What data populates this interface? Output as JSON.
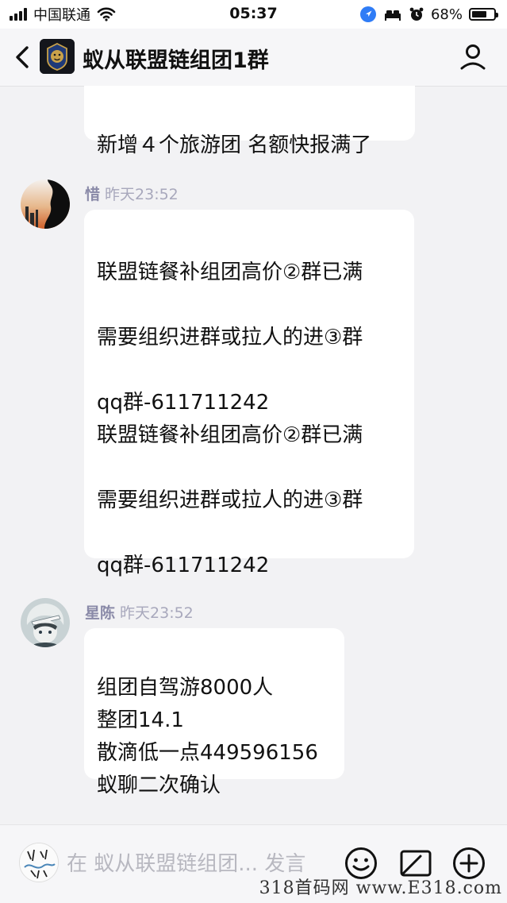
{
  "status_bar": {
    "carrier": "中国联通",
    "time": "05:37",
    "battery_percent": "68%",
    "battery_level": 0.68
  },
  "nav": {
    "title": "蚁从联盟链组团1群"
  },
  "messages": [
    {
      "text": "新增４个旅游团 名额快报满了"
    },
    {
      "sender": "惜",
      "time": "昨天23:52",
      "text": "联盟链餐补组团高价②群已满\n\n需要组织进群或拉人的进③群\n\n qq群-611711242\n联盟链餐补组团高价②群已满\n\n需要组织进群或拉人的进③群\n\n qq群-611711242"
    },
    {
      "sender": "星陈",
      "time": "昨天23:52",
      "text": "组团自驾游8000人\n整团14.1\n散滴低一点449596156\n蚁聊二次确认"
    }
  ],
  "input": {
    "placeholder": "在 蚁从联盟链组团... 发言"
  },
  "watermark": "318首码网  www.E318.com",
  "icons": [
    "signal-icon",
    "wifi-icon",
    "location-icon",
    "bed-icon",
    "alarm-icon",
    "battery-icon",
    "back-arrow-icon",
    "person-icon",
    "emoji-icon",
    "image-icon",
    "plus-icon"
  ]
}
